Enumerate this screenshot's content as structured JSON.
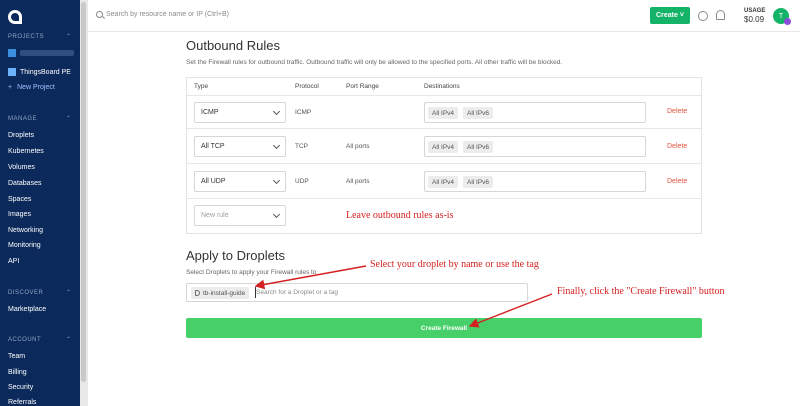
{
  "sidebar": {
    "sections": {
      "projects": "PROJECTS",
      "manage": "MANAGE",
      "discover": "DISCOVER",
      "account": "ACCOUNT"
    },
    "projects": [
      {
        "name": "ThingsBoard PE"
      }
    ],
    "new_project": "New Project",
    "manage_items": [
      "Droplets",
      "Kubernetes",
      "Volumes",
      "Databases",
      "Spaces",
      "Images",
      "Networking",
      "Monitoring",
      "API"
    ],
    "discover_items": [
      "Marketplace"
    ],
    "account_items": [
      "Team",
      "Billing",
      "Security",
      "Referrals"
    ]
  },
  "topbar": {
    "search_placeholder": "Search by resource name or IP (Ctrl+B)",
    "create_label": "Create",
    "usage_label": "USAGE",
    "usage_value": "$0.09",
    "avatar_initial": "T"
  },
  "outbound": {
    "title": "Outbound Rules",
    "description": "Set the Firewall rules for outbound traffic. Outbound traffic will only be allowed to the specified ports. All other traffic will be blocked.",
    "columns": {
      "type": "Type",
      "protocol": "Protocol",
      "port_range": "Port Range",
      "destinations": "Destinations"
    },
    "rows": [
      {
        "type": "ICMP",
        "protocol": "ICMP",
        "port_range": "",
        "dest_a": "All IPv4",
        "dest_b": "All IPv6",
        "action": "Delete"
      },
      {
        "type": "All TCP",
        "protocol": "TCP",
        "port_range": "All ports",
        "dest_a": "All IPv4",
        "dest_b": "All IPv6",
        "action": "Delete"
      },
      {
        "type": "All UDP",
        "protocol": "UDP",
        "port_range": "All ports",
        "dest_a": "All IPv4",
        "dest_b": "All IPv6",
        "action": "Delete"
      }
    ],
    "new_rule_placeholder": "New rule"
  },
  "apply": {
    "title": "Apply to Droplets",
    "description": "Select Droplets to apply your Firewall rules to",
    "tag": "tb-install-guide",
    "search_placeholder": "Search for a Droplet or a tag"
  },
  "create_firewall": "Create Firewall",
  "annotations": {
    "leave": "Leave outbound rules as-is",
    "select": "Select your droplet by name or use the tag",
    "finally": "Finally, click the \"Create Firewall\" button"
  },
  "colors": {
    "sidebar": "#0b2a5b",
    "brand_green": "#15b368",
    "button_green": "#47d06a",
    "delete_red": "#e0533d",
    "annotation_red": "#d42020"
  }
}
